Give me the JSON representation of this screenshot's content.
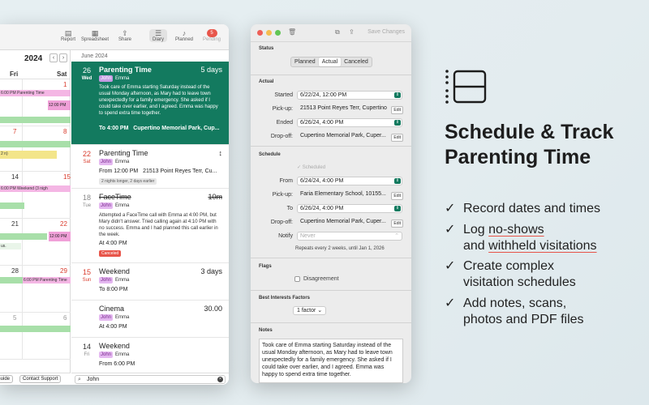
{
  "toolbar": {
    "report": "Report",
    "spreadsheet": "Spreadsheet",
    "share": "Share",
    "diary": "Diary",
    "planned": "Planned",
    "pending": "Pending",
    "pending_count": "5"
  },
  "calendar": {
    "year": "2024",
    "days": [
      "Fri",
      "Sat"
    ],
    "weeks": [
      {
        "fri": "",
        "sat": "1",
        "events": [
          "6:00 PM Parenting Time",
          "12:00 PM"
        ]
      },
      {
        "fri": "7",
        "sat": "8",
        "events": [
          "2 n)"
        ]
      },
      {
        "fri": "14",
        "sat": "15",
        "events": [
          "6:00 PM Weekend (3 nigh"
        ]
      },
      {
        "fri": "21",
        "sat": "22",
        "events": [
          "us.",
          "12:00 PM"
        ]
      },
      {
        "fri": "28",
        "sat": "29",
        "events": [
          "6:00 PM Parenting Time"
        ]
      },
      {
        "fri": "5",
        "sat": "6",
        "events": []
      }
    ],
    "footer_buttons": [
      "Guide",
      "Contact Support"
    ]
  },
  "diary": {
    "month": "June 2024",
    "entries": [
      {
        "day": "26",
        "weekday": "Wed",
        "title": "Parenting Time",
        "right": "5 days",
        "tag": "John",
        "who": "Emma",
        "desc": "Took care of Emma starting Saturday instead of the usual Monday afternoon, as Mary had to leave town unexpectedly for a family emergency. She asked if I could take over earlier, and I agreed. Emma was happy to spend extra time together.",
        "to": "To 4:00 PM",
        "place": "Cupertino Memorial Park, Cup..."
      },
      {
        "day": "22",
        "weekday": "Sat",
        "title": "Parenting Time",
        "right": "↕",
        "tag": "John",
        "who": "Emma",
        "from": "From 12:00 PM",
        "place": "21513 Point Reyes Terr, Cu...",
        "pill": "2 nights longer, 2 days earlier"
      },
      {
        "day": "18",
        "weekday": "Tue",
        "title": "FaceTime",
        "right": "10m",
        "tag": "John",
        "who": "Emma",
        "desc": "Attempted a FaceTime call with Emma at 4:00 PM, but Mary didn't answer. Tried calling again at 4:10 PM with no success. Emma and I had planned this call earlier in the week.",
        "at": "At 4:00 PM",
        "status": "Canceled"
      },
      {
        "day": "15",
        "weekday": "Sun",
        "title": "Weekend",
        "right": "3 days",
        "tag": "John",
        "who": "Emma",
        "to": "To 8:00 PM"
      },
      {
        "day": "",
        "weekday": "",
        "title": "Cinema",
        "right": "30.00",
        "tag": "John",
        "who": "Emma",
        "at": "At 4:00 PM"
      },
      {
        "day": "14",
        "weekday": "Fri",
        "title": "Weekend",
        "right": "",
        "tag": "John",
        "who": "Emma",
        "from": "From 6:00 PM"
      }
    ],
    "search_value": "John"
  },
  "inspector": {
    "save_label": "Save Changes",
    "status_title": "Status",
    "status_options": [
      "Planned",
      "Actual",
      "Canceled"
    ],
    "status_selected": "Actual",
    "actual_title": "Actual",
    "started_label": "Started",
    "started_value": "6/22/24, 12:00 PM",
    "pickup_label": "Pick-up:",
    "pickup_value": "21513 Point Reyes Terr, Cupertino",
    "ended_label": "Ended",
    "ended_value": "6/26/24, 4:00 PM",
    "dropoff_label": "Drop-off:",
    "dropoff_value": "Cupertino Memorial Park, Cuper...",
    "edit_label": "Edit",
    "schedule_title": "Schedule",
    "scheduled_label": "Scheduled",
    "from_label": "From",
    "from_value": "6/24/24, 4:00 PM",
    "s_pickup_value": "Faria Elementary School, 10155...",
    "to_label": "To",
    "to_value": "6/26/24, 4:00 PM",
    "s_dropoff_value": "Cupertino Memorial Park, Cuper...",
    "notify_label": "Notify",
    "notify_value": "Never",
    "repeat_text": "Repeats every 2 weeks, until Jan 1, 2026",
    "flags_title": "Flags",
    "flag_disagreement": "Disagreement",
    "bif_title": "Best Interests Factors",
    "bif_value": "1 factor ⌄",
    "notes_title": "Notes",
    "notes_text": "Took care of Emma starting Saturday instead of the usual Monday afternoon, as Mary had to leave town unexpectedly for a family emergency. She asked if I could take over earlier, and I agreed. Emma was happy to spend extra time together."
  },
  "marketing": {
    "headline_line1": "Schedule & Track",
    "headline_line2": "Parenting Time",
    "features": [
      {
        "l1": "Record dates and times"
      },
      {
        "l1": "Log ",
        "l1u": "no-shows",
        "l2": "and ",
        "l2u": "withheld visitations"
      },
      {
        "l1": "Create complex",
        "l2": "visitation schedules"
      },
      {
        "l1": "Add notes, scans,",
        "l2": "photos and PDF files"
      }
    ],
    "accent_color": "#e8554a",
    "brand_green": "#137a5f"
  }
}
